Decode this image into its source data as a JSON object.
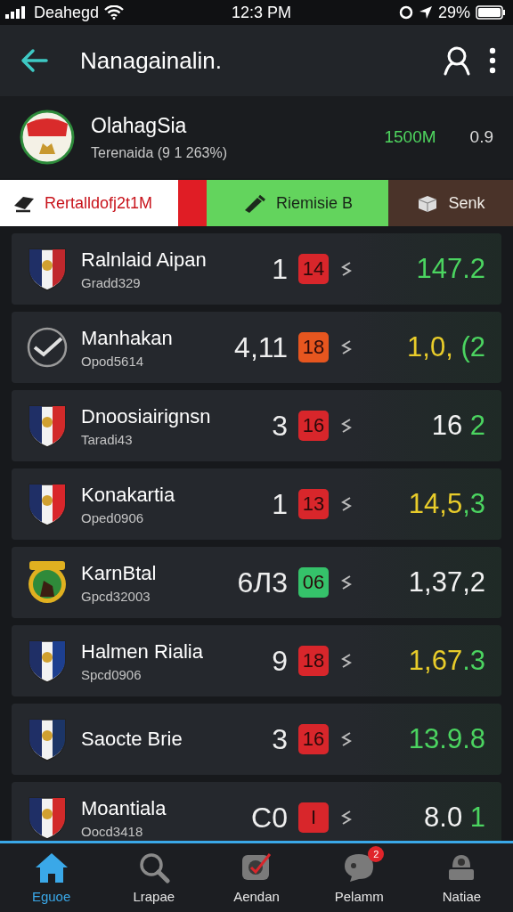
{
  "status_bar": {
    "carrier": "Deahegd",
    "time": "12:3 PM",
    "battery": "29%"
  },
  "app_bar": {
    "title": "Nanagainalin."
  },
  "club": {
    "name": "OlahagSia",
    "subtitle": "Terenaida (9 1 263%)",
    "value": "1500M",
    "ratio": "0.9"
  },
  "tabs": [
    {
      "label": "Rertalldofj2t1M",
      "kind": "split"
    },
    {
      "label": "Riemisie B",
      "kind": "green"
    },
    {
      "label": "Senk",
      "kind": "brown"
    }
  ],
  "rows": [
    {
      "name": "Ralnlaid Aipan",
      "code": "Gradd329",
      "kind": "shield",
      "rank": "1",
      "badge": {
        "text": "14",
        "color": "#d8262b"
      },
      "score": [
        {
          "text": "147.2",
          "color": "#4bd460"
        }
      ]
    },
    {
      "name": "Manhakan",
      "code": "Opod5614",
      "kind": "check",
      "rank": "4,11",
      "badge": {
        "text": "18",
        "color": "#e6561f"
      },
      "score": [
        {
          "text": "1,0,",
          "color": "#e8cc2a"
        },
        {
          "text": " (2",
          "color": "#4bd460"
        }
      ]
    },
    {
      "name": "Dnoosiairignsn",
      "code": "Taradi43",
      "kind": "shield",
      "rank": "3",
      "badge": {
        "text": "16",
        "color": "#d8262b"
      },
      "score": [
        {
          "text": "16",
          "color": "#f2f2f2"
        },
        {
          "text": " 2",
          "color": "#4bd460"
        }
      ]
    },
    {
      "name": "Konakartia",
      "code": "Oped0906",
      "kind": "shield",
      "rank": "1",
      "badge": {
        "text": "13",
        "color": "#d8262b"
      },
      "score": [
        {
          "text": "14,5",
          "color": "#e8cc2a"
        },
        {
          "text": ",3",
          "color": "#4bd460"
        }
      ]
    },
    {
      "name": "KarnBtal",
      "code": "Gpcd32003",
      "kind": "round",
      "rank": "6Л3",
      "badge": {
        "text": "06",
        "color": "#35c26a"
      },
      "score": [
        {
          "text": "1,37,2",
          "color": "#f2f2f2"
        }
      ]
    },
    {
      "name": "Halmen Rialia",
      "code": "Spcd0906",
      "kind": "shield",
      "rank": "9",
      "badge": {
        "text": "18",
        "color": "#d8262b"
      },
      "score": [
        {
          "text": "1,67",
          "color": "#e8cc2a"
        },
        {
          "text": ".3",
          "color": "#4bd460"
        }
      ]
    },
    {
      "name": "Saocte Brie",
      "kind": "shield",
      "rank": "3",
      "badge": {
        "text": "16",
        "color": "#d8262b"
      },
      "score": [
        {
          "text": "13.9.8",
          "color": "#4bd460"
        }
      ]
    },
    {
      "name": "Moantiala",
      "code": "Oocd3418",
      "kind": "shield",
      "rank": "C0",
      "badge": {
        "text": "I",
        "color": "#d8262b"
      },
      "score": [
        {
          "text": "8.0",
          "color": "#f2f2f2"
        },
        {
          "text": " 1",
          "color": "#4bd460"
        }
      ]
    }
  ],
  "nav": [
    {
      "label": "Eguoe",
      "selected": true
    },
    {
      "label": "Lrapae",
      "selected": false
    },
    {
      "label": "Aendan",
      "selected": false
    },
    {
      "label": "Pelamm",
      "selected": false,
      "badge": "2"
    },
    {
      "label": "Natiae",
      "selected": false
    }
  ]
}
